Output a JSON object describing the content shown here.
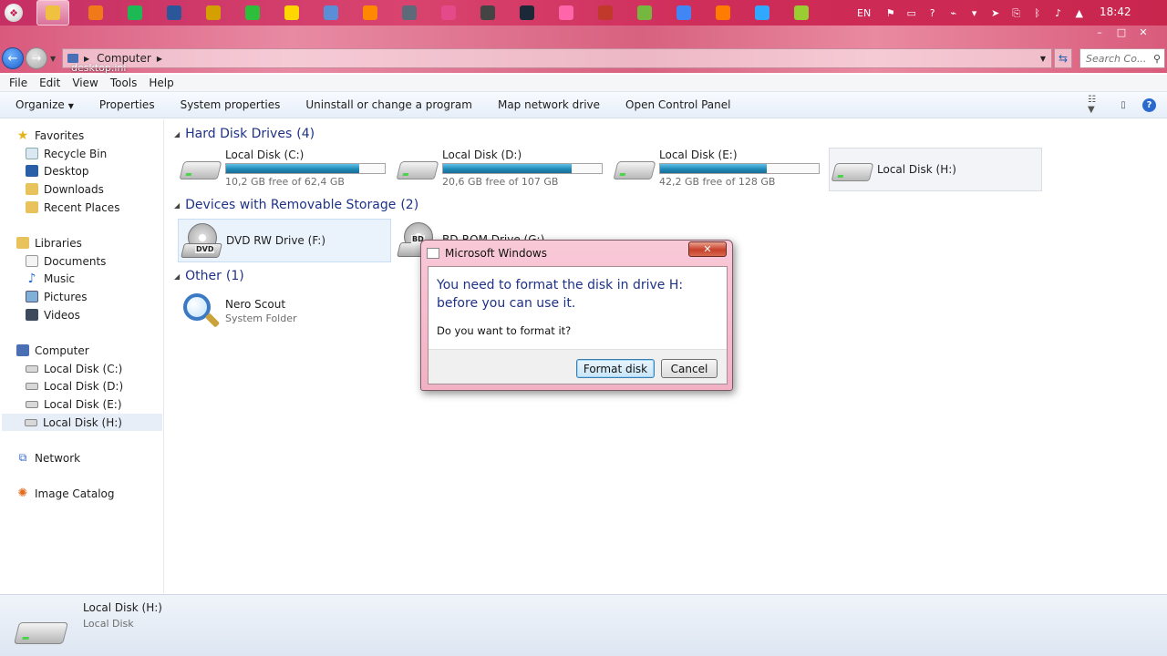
{
  "taskbar": {
    "language": "EN",
    "clock": "18:42",
    "apps": [
      {
        "icon": "file-explorer-icon",
        "color": "#f0c040",
        "active": true
      },
      {
        "icon": "avast-icon",
        "color": "#f07a1a"
      },
      {
        "icon": "spotify-icon",
        "color": "#1db954"
      },
      {
        "icon": "word-icon",
        "color": "#2b579a"
      },
      {
        "icon": "feather-icon",
        "color": "#d4a000"
      },
      {
        "icon": "line-icon",
        "color": "#2dbf3b"
      },
      {
        "icon": "kakaotalk-icon",
        "color": "#ffd600"
      },
      {
        "icon": "paint-icon",
        "color": "#5a8fd8"
      },
      {
        "icon": "vlc-icon",
        "color": "#ff8800"
      },
      {
        "icon": "steam-icon-alt",
        "color": "#5c6a7a"
      },
      {
        "icon": "paint-net-icon",
        "color": "#e44a8a"
      },
      {
        "icon": "film-icon",
        "color": "#444444"
      },
      {
        "icon": "steam-icon",
        "color": "#1b2838"
      },
      {
        "icon": "osu-icon",
        "color": "#ff66aa"
      },
      {
        "icon": "gift-icon",
        "color": "#c0392b"
      },
      {
        "icon": "utorrent-icon",
        "color": "#76b83f"
      },
      {
        "icon": "chrome-icon",
        "color": "#4285f4"
      },
      {
        "icon": "illustrator-icon",
        "color": "#ff7c00"
      },
      {
        "icon": "photoshop-icon",
        "color": "#31a8ff"
      },
      {
        "icon": "tennis-icon",
        "color": "#9acd32"
      }
    ]
  },
  "window": {
    "desktop_ghost_label": "desktop.ini",
    "address_crumb": "Computer",
    "search_placeholder": "Search Co...",
    "minimize": "–",
    "maximize": "□",
    "close": "✕"
  },
  "menu": [
    "File",
    "Edit",
    "View",
    "Tools",
    "Help"
  ],
  "commands": [
    "Organize",
    "Properties",
    "System properties",
    "Uninstall or change a program",
    "Map network drive",
    "Open Control Panel"
  ],
  "navpane": {
    "favorites": "Favorites",
    "favorites_items": [
      "Recycle Bin",
      "Desktop",
      "Downloads",
      "Recent Places"
    ],
    "libraries": "Libraries",
    "libraries_items": [
      "Documents",
      "Music",
      "Pictures",
      "Videos"
    ],
    "computer": "Computer",
    "computer_items": [
      "Local Disk (C:)",
      "Local Disk (D:)",
      "Local Disk (E:)",
      "Local Disk (H:)"
    ],
    "network": "Network",
    "image_catalog": "Image Catalog"
  },
  "groups": {
    "hdd": {
      "title": "Hard Disk Drives",
      "count": "(4)"
    },
    "removable": {
      "title": "Devices with Removable Storage",
      "count": "(2)"
    },
    "other": {
      "title": "Other",
      "count": "(1)"
    }
  },
  "drives": [
    {
      "name": "Local Disk (C:)",
      "free": "10,2 GB free of 62,4 GB",
      "used_fraction": 0.84
    },
    {
      "name": "Local Disk (D:)",
      "free": "20,6 GB free of 107 GB",
      "used_fraction": 0.81
    },
    {
      "name": "Local Disk (E:)",
      "free": "42,2 GB free of 128 GB",
      "used_fraction": 0.67
    },
    {
      "name": "Local Disk (H:)"
    }
  ],
  "removable": [
    {
      "name": "DVD RW Drive (F:)",
      "badge": "DVD"
    },
    {
      "name": "BD-ROM Drive (G:)",
      "badge": "BD"
    }
  ],
  "other": {
    "name": "Nero Scout",
    "type": "System Folder"
  },
  "details": {
    "name": "Local Disk (H:)",
    "type": "Local Disk"
  },
  "dialog": {
    "title": "Microsoft Windows",
    "main": "You need to format the disk in drive H: before you can use it.",
    "question": "Do you want to format it?",
    "ok": "Format disk",
    "cancel": "Cancel",
    "close": "✕"
  }
}
